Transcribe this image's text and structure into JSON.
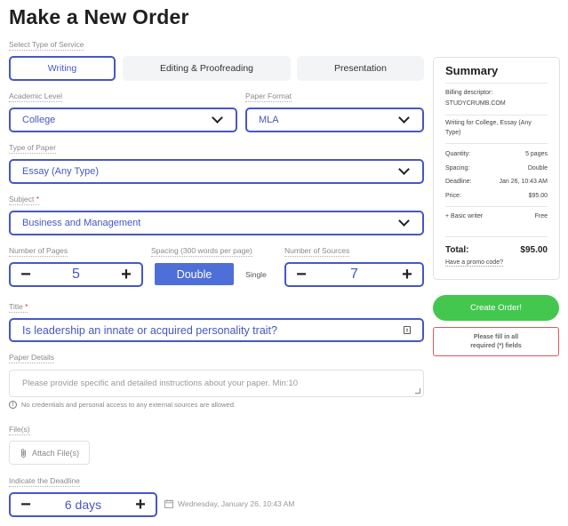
{
  "page_title": "Make a New Order",
  "service": {
    "label": "Select Type of Service",
    "options": [
      "Writing",
      "Editing & Proofreading",
      "Presentation"
    ],
    "selected": "Writing"
  },
  "academic_level": {
    "label": "Academic Level",
    "value": "College"
  },
  "paper_format": {
    "label": "Paper Format",
    "value": "MLA"
  },
  "type_of_paper": {
    "label": "Type of Paper",
    "value": "Essay (Any Type)"
  },
  "subject": {
    "label": "Subject",
    "required_mark": "*",
    "value": "Business and Management"
  },
  "pages": {
    "label": "Number of Pages",
    "value": "5",
    "minus": "−",
    "plus": "+"
  },
  "spacing": {
    "label": "Spacing (300 words per page)",
    "double": "Double",
    "single": "Single"
  },
  "sources": {
    "label": "Number of Sources",
    "value": "7",
    "minus": "−",
    "plus": "+"
  },
  "title_field": {
    "label": "Title",
    "required_mark": "*",
    "value": "Is leadership an innate or acquired personality trait?"
  },
  "paper_details": {
    "label": "Paper Details",
    "placeholder": "Please provide specific and detailed instructions about your paper. Min:10",
    "note": "No credentials and personal access to any external sources are allowed."
  },
  "files": {
    "label": "File(s)",
    "button": "Attach File(s)"
  },
  "deadline": {
    "label": "Indicate the Deadline",
    "value": "6 days",
    "minus": "−",
    "plus": "+",
    "date": "Wednesday, January 26, 10:43 AM"
  },
  "summary": {
    "title": "Summary",
    "billing_label": "Billing descriptor:",
    "billing_value": "STUDYCRUMB.COM",
    "description": "Writing for College, Essay (Any Type)",
    "rows": [
      {
        "k": "Quantity:",
        "v": "5 pages"
      },
      {
        "k": "Spacing:",
        "v": "Double"
      },
      {
        "k": "Deadline:",
        "v": "Jan 26, 10:43 AM"
      },
      {
        "k": "Price:",
        "v": "$95.00"
      }
    ],
    "extra_label": "+ Basic writer",
    "extra_value": "Free",
    "total_label": "Total:",
    "total_value": "$95.00",
    "promo": "Have a promo code?"
  },
  "create_button": "Create Order!",
  "warning": {
    "line1": "Please fill in all",
    "line2": "required (*) fields"
  }
}
